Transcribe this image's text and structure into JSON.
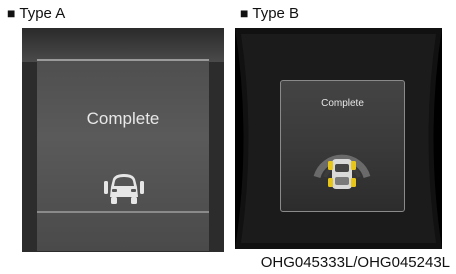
{
  "labels": {
    "type_a": "Type A",
    "type_b": "Type B",
    "bullet": "■"
  },
  "panel_a": {
    "message": "Complete",
    "icon": "vehicle-front-sensor-icon"
  },
  "panel_b": {
    "message": "Complete",
    "icon": "vehicle-steering-arc-icon"
  },
  "caption": "OHG045333L/OHG045243L",
  "colors": {
    "panel_bg": "#2c2c2c",
    "panel_b_bg": "#000000",
    "highlight": "#e8c619",
    "text_light": "#e8e8e8"
  }
}
